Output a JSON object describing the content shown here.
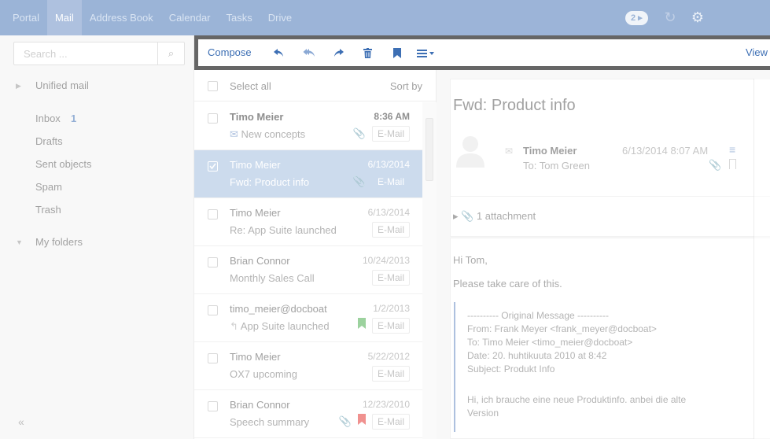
{
  "topbar": {
    "apps": [
      "Portal",
      "Mail",
      "Address Book",
      "Calendar",
      "Tasks",
      "Drive"
    ],
    "active": "Mail",
    "badge": "2 ▸",
    "brand_color": "#4a77b8"
  },
  "sidebar": {
    "search_placeholder": "Search ...",
    "unified": "Unified mail",
    "folders": [
      {
        "label": "Inbox",
        "count": "1"
      },
      {
        "label": "Drafts",
        "count": ""
      },
      {
        "label": "Sent objects",
        "count": ""
      },
      {
        "label": "Spam",
        "count": ""
      },
      {
        "label": "Trash",
        "count": ""
      }
    ],
    "my_folders": "My folders",
    "collapse": "«"
  },
  "toolbar": {
    "compose": "Compose",
    "view": "View",
    "icons": [
      "reply-icon",
      "reply-all-icon",
      "forward-icon",
      "delete-icon",
      "flag-icon",
      "more-menu-icon"
    ]
  },
  "list": {
    "select_all": "Select all",
    "sort_by": "Sort by",
    "mails": [
      {
        "from": "Timo Meier",
        "date": "8:36 AM",
        "subject": "New concepts",
        "tag": "E-Mail",
        "unread": true,
        "selected": false,
        "attachment": true,
        "flag": ""
      },
      {
        "from": "Timo Meier",
        "date": "6/13/2014",
        "subject": "Fwd: Product info",
        "tag": "E-Mail",
        "unread": false,
        "selected": true,
        "attachment": true,
        "flag": ""
      },
      {
        "from": "Timo Meier",
        "date": "6/13/2014",
        "subject": "Re: App Suite launched",
        "tag": "E-Mail",
        "unread": false,
        "selected": false,
        "attachment": false,
        "flag": ""
      },
      {
        "from": "Brian Connor",
        "date": "10/24/2013",
        "subject": "Monthly Sales Call",
        "tag": "E-Mail",
        "unread": false,
        "selected": false,
        "attachment": false,
        "flag": ""
      },
      {
        "from": "timo_meier@docboat",
        "date": "1/2/2013",
        "subject": "App Suite launched",
        "tag": "E-Mail",
        "unread": false,
        "selected": false,
        "attachment": false,
        "flag": "#4caf50"
      },
      {
        "from": "Timo Meier",
        "date": "5/22/2012",
        "subject": "OX7 upcoming",
        "tag": "E-Mail",
        "unread": false,
        "selected": false,
        "attachment": false,
        "flag": ""
      },
      {
        "from": "Brian Connor",
        "date": "12/23/2010",
        "subject": "Speech summary",
        "tag": "E-Mail",
        "unread": false,
        "selected": false,
        "attachment": true,
        "flag": "#e53935"
      }
    ]
  },
  "pane": {
    "subject": "Fwd: Product info",
    "sender": "Timo Meier",
    "to": "To: Tom Green",
    "date": "6/13/2014 8:07 AM",
    "attachments": "1 attachment",
    "greeting": "Hi Tom,",
    "line1": "Please take care of this.",
    "quote": [
      "---------- Original Message ----------",
      "From: Frank Meyer <frank_meyer@docboat>",
      "To: Timo Meier <timo_meier@docboat>",
      "Date: 20. huhtikuuta 2010 at 8:42",
      "Subject: Produkt Info",
      "",
      "Hi, ich brauche eine neue Produktinfo. anbei die alte",
      "Version"
    ]
  }
}
